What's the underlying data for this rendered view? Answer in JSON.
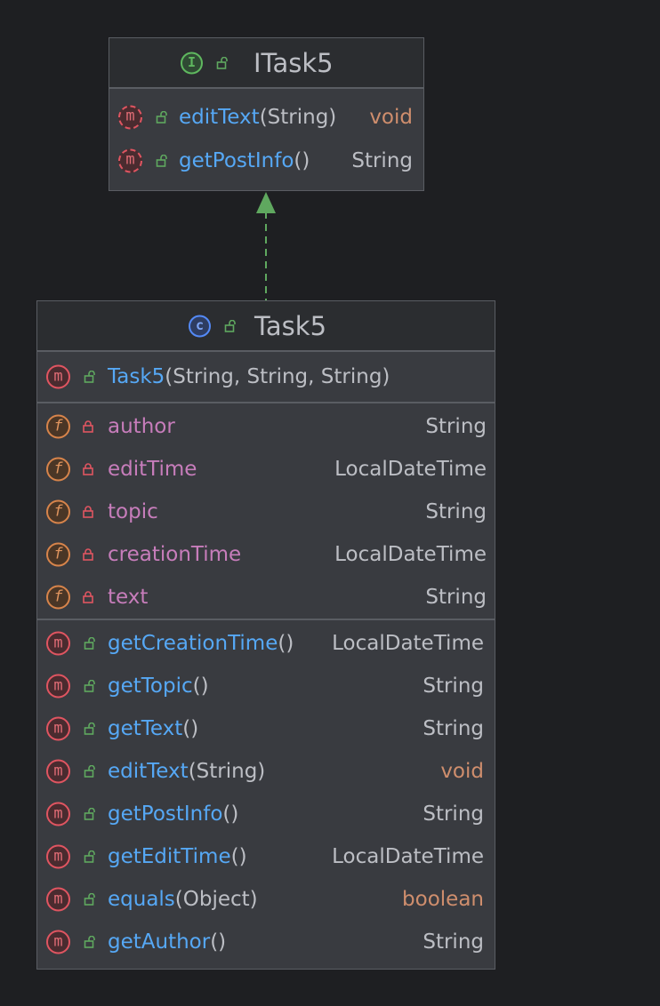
{
  "interface": {
    "name": "ITask5",
    "kind_icon": "interface-icon",
    "kind_glyph": "I",
    "methods": [
      {
        "name": "editText",
        "params": "(String)",
        "type": "void"
      },
      {
        "name": "getPostInfo",
        "params": "()",
        "type": "String"
      }
    ]
  },
  "klass": {
    "name": "Task5",
    "kind_icon": "class-icon",
    "kind_glyph": "c",
    "constructor": {
      "name": "Task5",
      "params": "(String, String, String)"
    },
    "fields": [
      {
        "name": "author",
        "type": "String"
      },
      {
        "name": "editTime",
        "type": "LocalDateTime"
      },
      {
        "name": "topic",
        "type": "String"
      },
      {
        "name": "creationTime",
        "type": "LocalDateTime"
      },
      {
        "name": "text",
        "type": "String"
      }
    ],
    "methods": [
      {
        "name": "getCreationTime",
        "params": "()",
        "type": "LocalDateTime"
      },
      {
        "name": "getTopic",
        "params": "()",
        "type": "String"
      },
      {
        "name": "getText",
        "params": "()",
        "type": "String"
      },
      {
        "name": "editText",
        "params": "(String)",
        "type": "void"
      },
      {
        "name": "getPostInfo",
        "params": "()",
        "type": "String"
      },
      {
        "name": "getEditTime",
        "params": "()",
        "type": "LocalDateTime"
      },
      {
        "name": "equals",
        "params": "(Object)",
        "type": "boolean"
      },
      {
        "name": "getAuthor",
        "params": "()",
        "type": "String"
      }
    ]
  },
  "glyphs": {
    "method": "m",
    "field": "f"
  },
  "colors": {
    "background": "#1e1f22",
    "box": "#393b40",
    "header": "#2b2d30",
    "border": "#5a5d63",
    "method_name": "#56a8f5",
    "field_name": "#c77dbb",
    "keyword_type": "#cf8e6d",
    "arrow": "#5fa85f"
  }
}
